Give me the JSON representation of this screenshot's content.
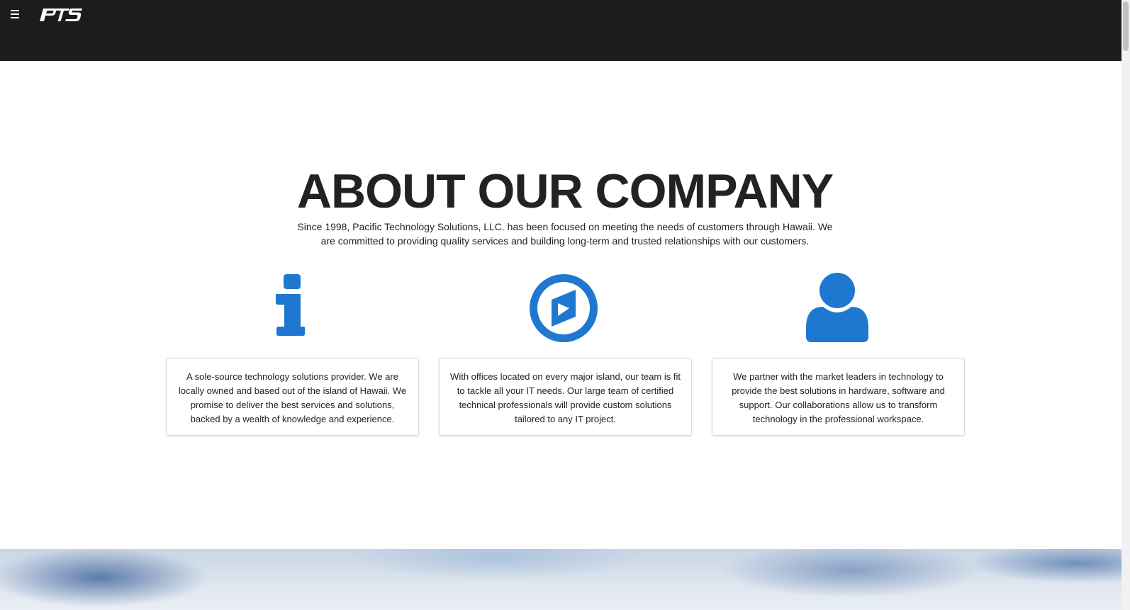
{
  "header": {
    "menu_icon": "hamburger-menu-icon",
    "logo_text": "PTS"
  },
  "about": {
    "title": "ABOUT OUR COMPANY",
    "intro": "Since 1998, Pacific Technology Solutions, LLC. has been focused on meeting the needs of customers through Hawaii. We are committed to providing quality services and building long-term and trusted relationships with our customers."
  },
  "features": [
    {
      "icon": "info-icon",
      "text": "A sole-source technology solutions provider. We are locally owned and based out of the island of Hawaii. We promise to deliver the best services and solutions, backed by a wealth of knowledge and experience."
    },
    {
      "icon": "play-circle-icon",
      "text": "With offices located on every major island, our team is fit to tackle all your IT needs. Our large team of certified technical professionals will provide custom solutions tailored to any IT project."
    },
    {
      "icon": "user-icon",
      "text": "We partner with the market leaders in technology to provide the best solutions in hardware, software and support. Our collaborations allow us to transform technology in the professional workspace."
    }
  ],
  "colors": {
    "header_bg": "#1c1c1c",
    "accent_blue": "#1f78cf",
    "text": "#222222"
  }
}
